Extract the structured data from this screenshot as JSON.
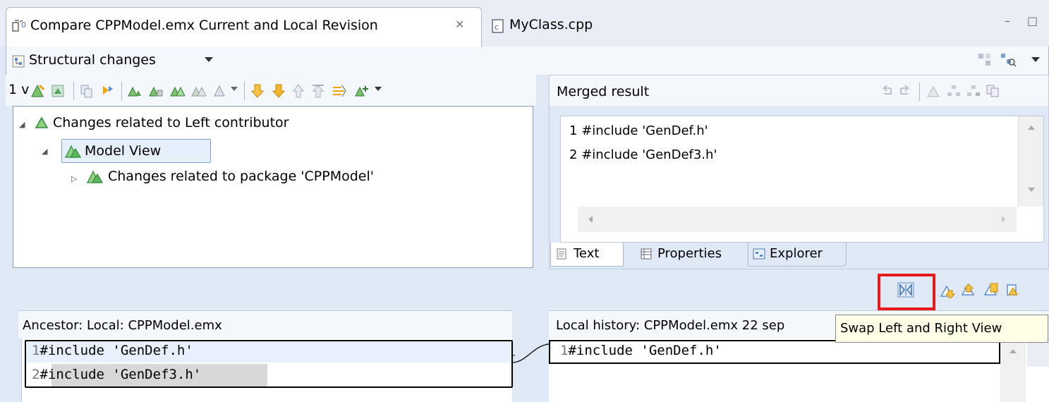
{
  "tabs": {
    "active": {
      "title": "Compare CPPModel.emx Current and Local Revision",
      "close_glyph": "✕"
    },
    "second": {
      "title": "MyClass.cpp"
    }
  },
  "window_controls": {
    "minimize": "–",
    "maximize": "□"
  },
  "structural": {
    "label": "Structural changes"
  },
  "toolbar": {
    "version_label": "1 v"
  },
  "tree": {
    "root": "Changes related to Left contributor",
    "child": "Model View",
    "grandchild": "Changes related to package 'CPPModel'"
  },
  "merged": {
    "header": "Merged result",
    "lines": [
      {
        "num": "1",
        "text": "#include 'GenDef.h'"
      },
      {
        "num": "2",
        "text": "#include 'GenDef3.h'"
      }
    ],
    "tabs": [
      "Text",
      "Properties",
      "Explorer"
    ]
  },
  "ancestor": {
    "header": "Ancestor: Local: CPPModel.emx",
    "lines": [
      {
        "num": "1",
        "text": "#include 'GenDef.h'"
      },
      {
        "num": "2",
        "text": "#include 'GenDef3.h'"
      }
    ]
  },
  "local": {
    "header": "Local history: CPPModel.emx 22 sep",
    "lines": [
      {
        "num": "1",
        "text": "#include 'GenDef.h'"
      }
    ]
  },
  "tooltip": {
    "text": "Swap Left and Right View"
  },
  "colors": {
    "accent_red": "#e8191b",
    "green_icon": "#2e9b3a",
    "orange_icon": "#f0a500",
    "panel_bg": "#dfe8f5"
  }
}
